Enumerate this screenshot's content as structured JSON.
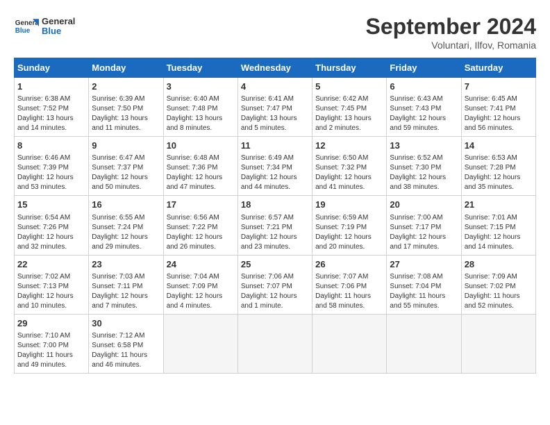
{
  "header": {
    "logo_general": "General",
    "logo_blue": "Blue",
    "month": "September 2024",
    "location": "Voluntari, Ilfov, Romania"
  },
  "weekdays": [
    "Sunday",
    "Monday",
    "Tuesday",
    "Wednesday",
    "Thursday",
    "Friday",
    "Saturday"
  ],
  "weeks": [
    [
      {
        "day": "1",
        "info": "Sunrise: 6:38 AM\nSunset: 7:52 PM\nDaylight: 13 hours\nand 14 minutes."
      },
      {
        "day": "2",
        "info": "Sunrise: 6:39 AM\nSunset: 7:50 PM\nDaylight: 13 hours\nand 11 minutes."
      },
      {
        "day": "3",
        "info": "Sunrise: 6:40 AM\nSunset: 7:48 PM\nDaylight: 13 hours\nand 8 minutes."
      },
      {
        "day": "4",
        "info": "Sunrise: 6:41 AM\nSunset: 7:47 PM\nDaylight: 13 hours\nand 5 minutes."
      },
      {
        "day": "5",
        "info": "Sunrise: 6:42 AM\nSunset: 7:45 PM\nDaylight: 13 hours\nand 2 minutes."
      },
      {
        "day": "6",
        "info": "Sunrise: 6:43 AM\nSunset: 7:43 PM\nDaylight: 12 hours\nand 59 minutes."
      },
      {
        "day": "7",
        "info": "Sunrise: 6:45 AM\nSunset: 7:41 PM\nDaylight: 12 hours\nand 56 minutes."
      }
    ],
    [
      {
        "day": "8",
        "info": "Sunrise: 6:46 AM\nSunset: 7:39 PM\nDaylight: 12 hours\nand 53 minutes."
      },
      {
        "day": "9",
        "info": "Sunrise: 6:47 AM\nSunset: 7:37 PM\nDaylight: 12 hours\nand 50 minutes."
      },
      {
        "day": "10",
        "info": "Sunrise: 6:48 AM\nSunset: 7:36 PM\nDaylight: 12 hours\nand 47 minutes."
      },
      {
        "day": "11",
        "info": "Sunrise: 6:49 AM\nSunset: 7:34 PM\nDaylight: 12 hours\nand 44 minutes."
      },
      {
        "day": "12",
        "info": "Sunrise: 6:50 AM\nSunset: 7:32 PM\nDaylight: 12 hours\nand 41 minutes."
      },
      {
        "day": "13",
        "info": "Sunrise: 6:52 AM\nSunset: 7:30 PM\nDaylight: 12 hours\nand 38 minutes."
      },
      {
        "day": "14",
        "info": "Sunrise: 6:53 AM\nSunset: 7:28 PM\nDaylight: 12 hours\nand 35 minutes."
      }
    ],
    [
      {
        "day": "15",
        "info": "Sunrise: 6:54 AM\nSunset: 7:26 PM\nDaylight: 12 hours\nand 32 minutes."
      },
      {
        "day": "16",
        "info": "Sunrise: 6:55 AM\nSunset: 7:24 PM\nDaylight: 12 hours\nand 29 minutes."
      },
      {
        "day": "17",
        "info": "Sunrise: 6:56 AM\nSunset: 7:22 PM\nDaylight: 12 hours\nand 26 minutes."
      },
      {
        "day": "18",
        "info": "Sunrise: 6:57 AM\nSunset: 7:21 PM\nDaylight: 12 hours\nand 23 minutes."
      },
      {
        "day": "19",
        "info": "Sunrise: 6:59 AM\nSunset: 7:19 PM\nDaylight: 12 hours\nand 20 minutes."
      },
      {
        "day": "20",
        "info": "Sunrise: 7:00 AM\nSunset: 7:17 PM\nDaylight: 12 hours\nand 17 minutes."
      },
      {
        "day": "21",
        "info": "Sunrise: 7:01 AM\nSunset: 7:15 PM\nDaylight: 12 hours\nand 14 minutes."
      }
    ],
    [
      {
        "day": "22",
        "info": "Sunrise: 7:02 AM\nSunset: 7:13 PM\nDaylight: 12 hours\nand 10 minutes."
      },
      {
        "day": "23",
        "info": "Sunrise: 7:03 AM\nSunset: 7:11 PM\nDaylight: 12 hours\nand 7 minutes."
      },
      {
        "day": "24",
        "info": "Sunrise: 7:04 AM\nSunset: 7:09 PM\nDaylight: 12 hours\nand 4 minutes."
      },
      {
        "day": "25",
        "info": "Sunrise: 7:06 AM\nSunset: 7:07 PM\nDaylight: 12 hours\nand 1 minute."
      },
      {
        "day": "26",
        "info": "Sunrise: 7:07 AM\nSunset: 7:06 PM\nDaylight: 11 hours\nand 58 minutes."
      },
      {
        "day": "27",
        "info": "Sunrise: 7:08 AM\nSunset: 7:04 PM\nDaylight: 11 hours\nand 55 minutes."
      },
      {
        "day": "28",
        "info": "Sunrise: 7:09 AM\nSunset: 7:02 PM\nDaylight: 11 hours\nand 52 minutes."
      }
    ],
    [
      {
        "day": "29",
        "info": "Sunrise: 7:10 AM\nSunset: 7:00 PM\nDaylight: 11 hours\nand 49 minutes."
      },
      {
        "day": "30",
        "info": "Sunrise: 7:12 AM\nSunset: 6:58 PM\nDaylight: 11 hours\nand 46 minutes."
      },
      {
        "day": "",
        "info": ""
      },
      {
        "day": "",
        "info": ""
      },
      {
        "day": "",
        "info": ""
      },
      {
        "day": "",
        "info": ""
      },
      {
        "day": "",
        "info": ""
      }
    ]
  ]
}
